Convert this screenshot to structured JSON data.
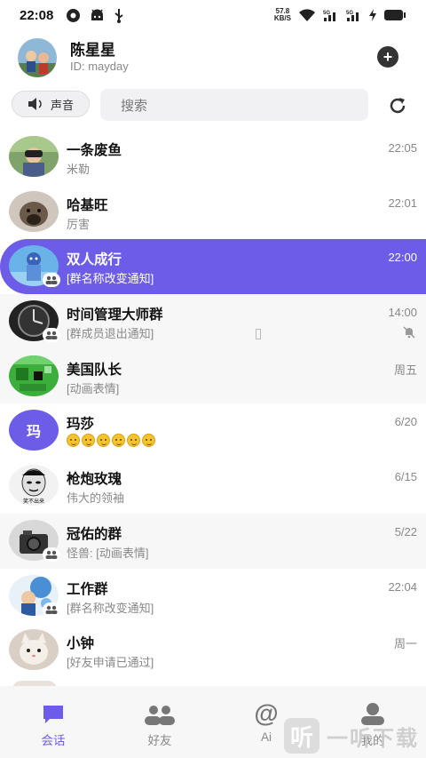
{
  "status_bar": {
    "time": "22:08",
    "net_speed_value": "57.8",
    "net_speed_unit": "KB/S",
    "signal1": "5G",
    "signal2": "5G"
  },
  "profile": {
    "name": "陈星星",
    "id": "ID: mayday"
  },
  "toolbar": {
    "sound_label": "声音",
    "search_placeholder": "搜索"
  },
  "colors": {
    "accent": "#6c5ce7",
    "text_secondary": "#888888"
  },
  "chats": [
    {
      "name": "一条废鱼",
      "preview": "米勒",
      "time": "22:05",
      "avatar": "photo-binoculars",
      "group": false
    },
    {
      "name": "哈基旺",
      "preview": "厉害",
      "time": "22:01",
      "avatar": "photo-dog",
      "group": false
    },
    {
      "name": "双人成行",
      "preview": "[群名称改变通知]",
      "time": "22:00",
      "avatar": "photo-character",
      "group": true,
      "selected": true
    },
    {
      "name": "时间管理大师群",
      "preview": "[群成员退出通知]",
      "time": "14:00",
      "avatar": "photo-watch",
      "group": true,
      "muted": true
    },
    {
      "name": "美国队长",
      "preview": "[动画表情]",
      "time": "周五",
      "avatar": "pixel-art",
      "group": false
    },
    {
      "name": "玛莎",
      "avatar_text": "玛",
      "time": "6/20",
      "preview_emojis": 6,
      "group": false
    },
    {
      "name": "枪炮玫瑰",
      "preview": "伟大的领袖",
      "time": "6/15",
      "avatar": "meme-face",
      "avatar_caption": "笑不出来",
      "group": false
    },
    {
      "name": "冠佑的群",
      "preview": "怪兽: [动画表情]",
      "time": "5/22",
      "avatar": "photo-camera",
      "group": true
    },
    {
      "name": "工作群",
      "preview": "[群名称改变通知]",
      "time": "22:04",
      "avatar": "anime-art",
      "group": true
    },
    {
      "name": "小钟",
      "preview": "[好友申请已通过]",
      "time": "周一",
      "avatar": "photo-cat",
      "group": false
    }
  ],
  "nav": {
    "chats": "会话",
    "friends": "好友",
    "ai": "Ai",
    "me": "我的"
  },
  "watermark": {
    "logo_char": "听",
    "text": "一听下载"
  }
}
